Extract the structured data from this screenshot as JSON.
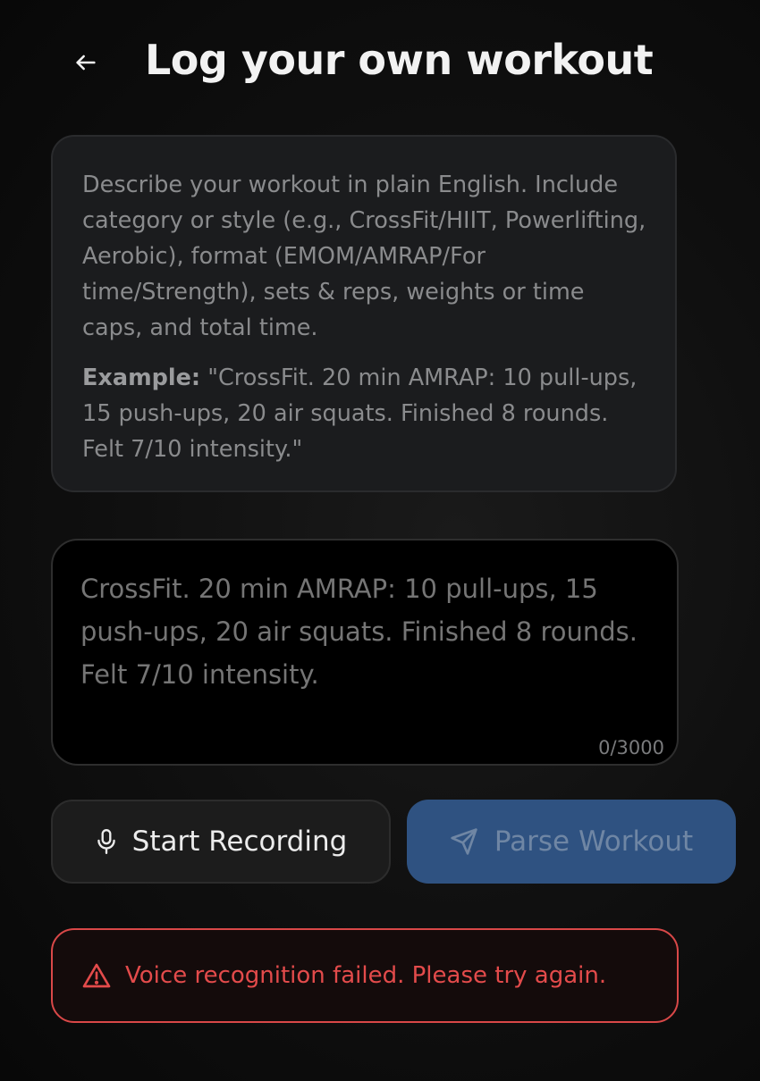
{
  "header": {
    "title": "Log your own workout",
    "back_icon": "arrow-left-icon"
  },
  "hint": {
    "description": "Describe your workout in plain English. Include category or style (e.g., CrossFit/HIIT, Powerlifting, Aerobic), format (EMOM/AMRAP/For time/Strength), sets & reps, weights or time caps, and total time.",
    "example_label": "Example:",
    "example_text": " \"CrossFit. 20 min AMRAP: 10 pull-ups, 15 push-ups, 20 air squats. Finished 8 rounds. Felt 7/10 intensity.\""
  },
  "input": {
    "placeholder": "CrossFit. 20 min AMRAP: 10 pull-ups, 15 push-ups, 20 air squats. Finished 8 rounds. Felt 7/10 intensity.",
    "value": "",
    "char_count": "0/3000"
  },
  "actions": {
    "record_label": "Start Recording",
    "record_icon": "microphone-icon",
    "parse_label": "Parse Workout",
    "parse_icon": "send-icon"
  },
  "error": {
    "icon": "warning-triangle-icon",
    "message": "Voice recognition failed. Please try again."
  },
  "colors": {
    "accent_blue": "#2f5281",
    "error_red": "#e34b4b"
  }
}
